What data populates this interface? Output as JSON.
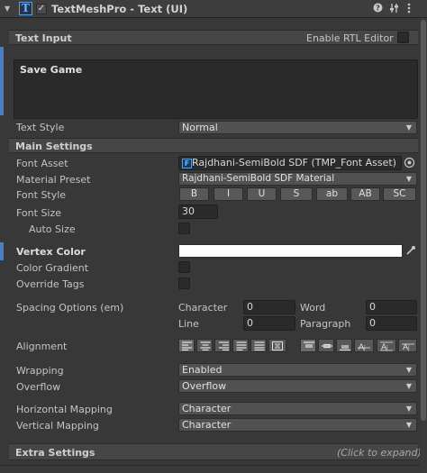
{
  "header": {
    "title": "TextMeshPro - Text (UI)",
    "enabled": true,
    "icons": [
      "foldout-arrow-icon",
      "textmeshpro-icon",
      "help-icon",
      "preset-icon",
      "menu-icon"
    ]
  },
  "text_input": {
    "section_label": "Text Input",
    "rtl_label": "Enable RTL Editor",
    "text": "Save Game",
    "text_style_label": "Text Style",
    "text_style_value": "Normal"
  },
  "main": {
    "section_label": "Main Settings",
    "font_asset_label": "Font Asset",
    "font_asset_value": "Rajdhani-SemiBold SDF (TMP_Font Asset)",
    "material_preset_label": "Material Preset",
    "material_preset_value": "Rajdhani-SemiBold SDF Material",
    "font_style_label": "Font Style",
    "font_style_buttons": [
      "B",
      "I",
      "U",
      "S",
      "ab",
      "AB",
      "SC"
    ],
    "font_size_label": "Font Size",
    "font_size_value": "30",
    "auto_size_label": "Auto Size",
    "vertex_color_label": "Vertex Color",
    "vertex_color": "#ffffff",
    "color_gradient_label": "Color Gradient",
    "override_tags_label": "Override Tags",
    "spacing_label": "Spacing Options (em)",
    "character_label": "Character",
    "character_value": "0",
    "word_label": "Word",
    "word_value": "0",
    "line_label": "Line",
    "line_value": "0",
    "paragraph_label": "Paragraph",
    "paragraph_value": "0",
    "alignment_label": "Alignment",
    "wrapping_label": "Wrapping",
    "wrapping_value": "Enabled",
    "overflow_label": "Overflow",
    "overflow_value": "Overflow",
    "hmap_label": "Horizontal Mapping",
    "hmap_value": "Character",
    "vmap_label": "Vertical Mapping",
    "vmap_value": "Character"
  },
  "extra": {
    "section_label": "Extra Settings",
    "hint": "(Click to expand)"
  },
  "colors": {
    "accent": "#4c7fc2",
    "background": "#383838"
  }
}
